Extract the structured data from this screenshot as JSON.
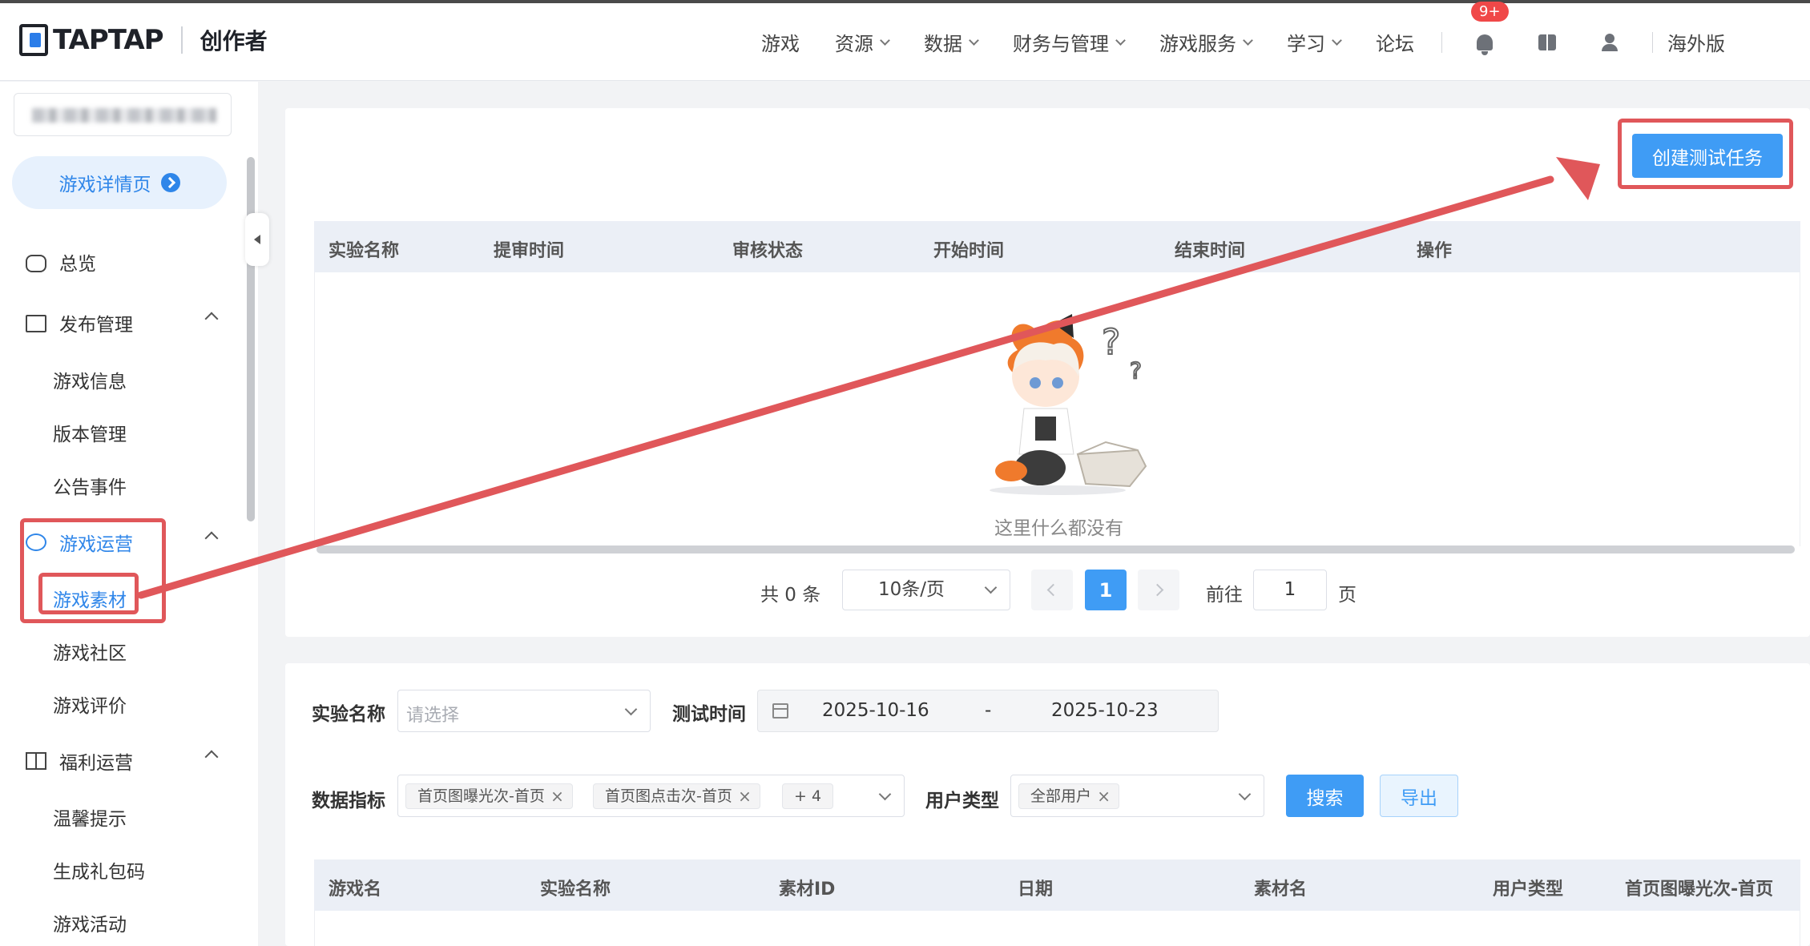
{
  "header": {
    "logo_text": "TAPTAP",
    "logo_sub": "创作者",
    "nav": [
      "游戏",
      "资源",
      "数据",
      "财务与管理",
      "游戏服务",
      "学习",
      "论坛"
    ],
    "nav_has_dropdown": [
      false,
      true,
      true,
      true,
      true,
      true,
      false
    ],
    "notification_badge": "9+",
    "region": "海外版"
  },
  "sidebar": {
    "detail_button": "游戏详情页",
    "overview": "总览",
    "publish_group": "发布管理",
    "publish_items": [
      "游戏信息",
      "版本管理",
      "公告事件"
    ],
    "ops_group": "游戏运营",
    "ops_items": [
      "游戏素材",
      "游戏社区",
      "游戏评价"
    ],
    "welfare_group": "福利运营",
    "welfare_items": [
      "温馨提示",
      "生成礼包码",
      "游戏活动"
    ]
  },
  "tasks": {
    "create_button": "创建测试任务",
    "columns": [
      "实验名称",
      "提审时间",
      "审核状态",
      "开始时间",
      "结束时间",
      "操作"
    ],
    "empty_text": "这里什么都没有",
    "pagination": {
      "total": "共 0 条",
      "page_size": "10条/页",
      "current_page": "1",
      "goto_label": "前往",
      "goto_value": "1",
      "page_label": "页"
    }
  },
  "filters": {
    "experiment_label": "实验名称",
    "experiment_placeholder": "请选择",
    "time_label": "测试时间",
    "start_date": "2025-10-16",
    "date_sep": "-",
    "end_date": "2025-10-23",
    "metrics_label": "数据指标",
    "metric_tags": [
      "首页图曝光次-首页",
      "首页图点击次-首页"
    ],
    "more_tags": "+ 4",
    "user_type_label": "用户类型",
    "user_type_tag": "全部用户",
    "search_button": "搜索",
    "export_button": "导出"
  },
  "results": {
    "columns": [
      "游戏名",
      "实验名称",
      "素材ID",
      "日期",
      "素材名",
      "用户类型",
      "首页图曝光次-首页"
    ]
  },
  "colors": {
    "primary": "#3f9cf5",
    "annotation": "#e0575a",
    "table_header": "#ebeff6"
  }
}
